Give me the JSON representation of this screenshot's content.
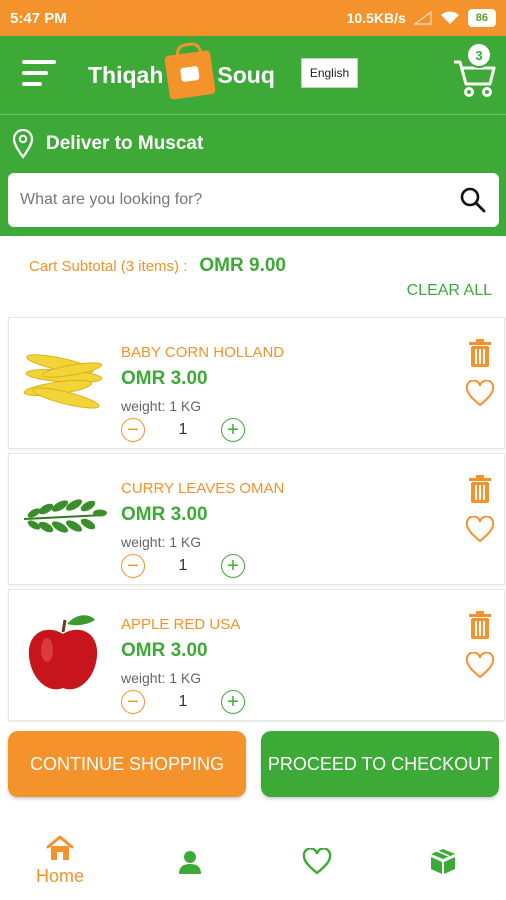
{
  "status_bar": {
    "time": "5:47 PM",
    "network_speed": "10.5KB/s",
    "battery": "86"
  },
  "header": {
    "brand_left": "Thiqah",
    "brand_right": "Souq",
    "language_button": "English",
    "cart_count": "3"
  },
  "location": {
    "label": "Deliver to Muscat"
  },
  "search": {
    "placeholder": "What are you looking for?"
  },
  "cart": {
    "subtotal_label": "Cart Subtotal  (3 items) :",
    "subtotal_amount": "OMR 9.00",
    "clear_all": "CLEAR ALL",
    "items": [
      {
        "name": "BABY CORN HOLLAND",
        "price": "OMR 3.00",
        "weight": "weight: 1 KG",
        "quantity": "1",
        "image": "baby-corn"
      },
      {
        "name": "CURRY LEAVES OMAN",
        "price": "OMR 3.00",
        "weight": "weight: 1 KG",
        "quantity": "1",
        "image": "curry-leaves"
      },
      {
        "name": "APPLE RED USA",
        "price": "OMR 3.00",
        "weight": "weight: 1 KG",
        "quantity": "1",
        "image": "red-apple"
      }
    ]
  },
  "actions": {
    "continue": "CONTINUE SHOPPING",
    "checkout": "PROCEED TO CHECKOUT"
  },
  "bottom_nav": {
    "home_label": "Home"
  },
  "colors": {
    "green": "#3daa38",
    "orange": "#f4922b"
  }
}
